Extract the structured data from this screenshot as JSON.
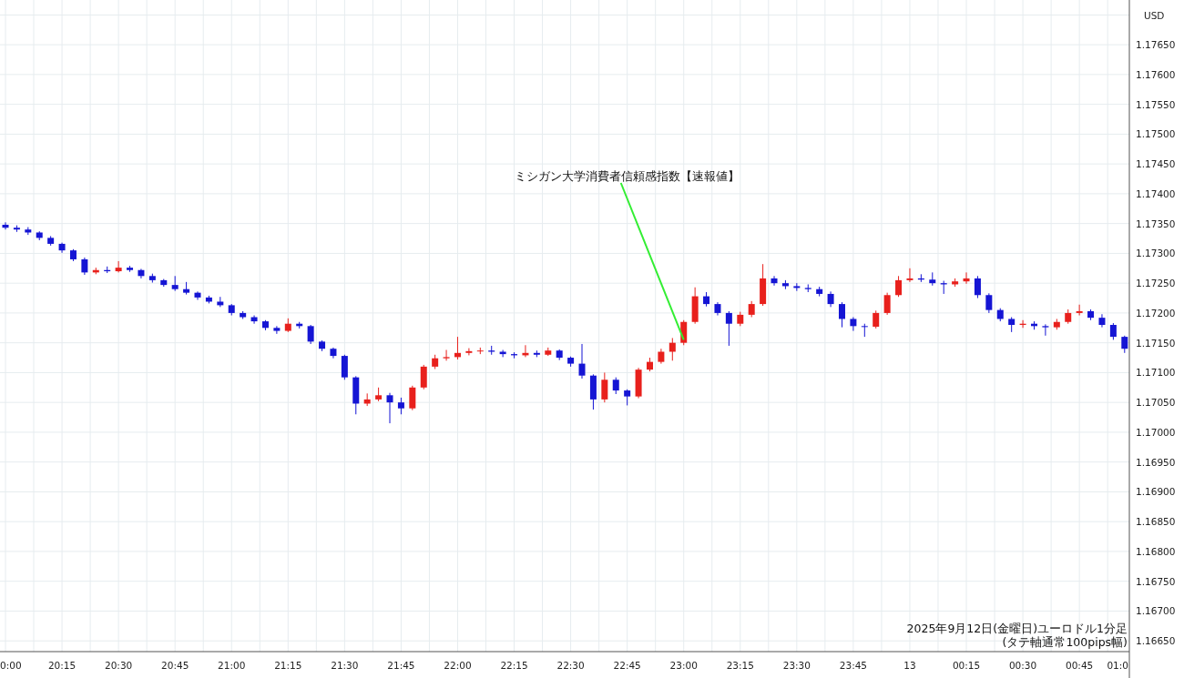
{
  "currency": "USD",
  "chart_data": {
    "type": "candlestick",
    "categories": [
      null,
      null,
      null,
      null,
      null,
      "20:15",
      null,
      null,
      null,
      null,
      "20:30",
      null,
      null,
      null,
      null,
      "20:45",
      null,
      null,
      null,
      null,
      "21:00",
      null,
      null,
      null,
      null,
      "21:15",
      null,
      null,
      null,
      null,
      "21:30",
      null,
      null,
      null,
      null,
      "21:45",
      null,
      null,
      null,
      null,
      "22:00",
      null,
      null,
      null,
      null,
      "22:15",
      null,
      null,
      null,
      null,
      "22:30",
      null,
      null,
      null,
      null,
      "22:45",
      null,
      null,
      null,
      null,
      "23:00",
      null,
      null,
      null,
      null,
      "23:15",
      null,
      null,
      null,
      null,
      "23:30",
      null,
      null,
      null,
      null,
      "23:45",
      null,
      null,
      null,
      null,
      "13",
      null,
      null,
      null,
      null,
      "00:15",
      null,
      null,
      null,
      null,
      "00:30",
      null,
      null,
      null,
      null,
      "00:45",
      null,
      null,
      null,
      null
    ],
    "ohlc": [
      [
        1.17348,
        1.17352,
        1.1734,
        1.17343
      ],
      [
        1.17343,
        1.17347,
        1.17336,
        1.1734
      ],
      [
        1.1734,
        1.17344,
        1.17331,
        1.17335
      ],
      [
        1.17335,
        1.17337,
        1.17322,
        1.17326
      ],
      [
        1.17326,
        1.17329,
        1.17313,
        1.17316
      ],
      [
        1.17316,
        1.17318,
        1.17301,
        1.17305
      ],
      [
        1.17305,
        1.17307,
        1.17287,
        1.1729
      ],
      [
        1.1729,
        1.17293,
        1.17264,
        1.17268
      ],
      [
        1.17268,
        1.17276,
        1.17265,
        1.17272
      ],
      [
        1.17272,
        1.17278,
        1.17267,
        1.1727
      ],
      [
        1.1727,
        1.17287,
        1.17268,
        1.17276
      ],
      [
        1.17276,
        1.17279,
        1.17269,
        1.17272
      ],
      [
        1.17272,
        1.17274,
        1.17258,
        1.17262
      ],
      [
        1.17262,
        1.17266,
        1.17251,
        1.17255
      ],
      [
        1.17255,
        1.17257,
        1.17244,
        1.17247
      ],
      [
        1.17247,
        1.17262,
        1.17237,
        1.1724
      ],
      [
        1.1724,
        1.17252,
        1.17231,
        1.17234
      ],
      [
        1.17234,
        1.17236,
        1.17222,
        1.17226
      ],
      [
        1.17226,
        1.17229,
        1.17216,
        1.17219
      ],
      [
        1.17219,
        1.17227,
        1.1721,
        1.17213
      ],
      [
        1.17213,
        1.17215,
        1.17196,
        1.172
      ],
      [
        1.172,
        1.17203,
        1.1719,
        1.17193
      ],
      [
        1.17193,
        1.17196,
        1.17182,
        1.17186
      ],
      [
        1.17186,
        1.17188,
        1.17171,
        1.17175
      ],
      [
        1.17175,
        1.17178,
        1.17165,
        1.1717
      ],
      [
        1.1717,
        1.17191,
        1.17168,
        1.17182
      ],
      [
        1.17182,
        1.17185,
        1.17174,
        1.17178
      ],
      [
        1.17178,
        1.1718,
        1.17148,
        1.17152
      ],
      [
        1.17152,
        1.17154,
        1.17136,
        1.1714
      ],
      [
        1.1714,
        1.17142,
        1.17124,
        1.17128
      ],
      [
        1.17128,
        1.1713,
        1.17088,
        1.17092
      ],
      [
        1.17092,
        1.17094,
        1.1703,
        1.17048
      ],
      [
        1.17048,
        1.17065,
        1.17044,
        1.17055
      ],
      [
        1.17055,
        1.17075,
        1.17052,
        1.17062
      ],
      [
        1.17062,
        1.17066,
        1.17015,
        1.1705
      ],
      [
        1.1705,
        1.17058,
        1.1703,
        1.1704
      ],
      [
        1.1704,
        1.17078,
        1.17037,
        1.17075
      ],
      [
        1.17075,
        1.17113,
        1.17072,
        1.1711
      ],
      [
        1.1711,
        1.1713,
        1.17106,
        1.17124
      ],
      [
        1.17124,
        1.17138,
        1.1712,
        1.17126
      ],
      [
        1.17126,
        1.1716,
        1.17122,
        1.17133
      ],
      [
        1.17133,
        1.17141,
        1.17129,
        1.17136
      ],
      [
        1.17136,
        1.17142,
        1.17131,
        1.17137
      ],
      [
        1.17137,
        1.17145,
        1.1713,
        1.17135
      ],
      [
        1.17135,
        1.17138,
        1.17126,
        1.17131
      ],
      [
        1.17131,
        1.17134,
        1.17124,
        1.17129
      ],
      [
        1.17129,
        1.17146,
        1.17126,
        1.17133
      ],
      [
        1.17133,
        1.17137,
        1.17126,
        1.1713
      ],
      [
        1.1713,
        1.17142,
        1.17128,
        1.17137
      ],
      [
        1.17137,
        1.17139,
        1.17121,
        1.17125
      ],
      [
        1.17125,
        1.17127,
        1.1711,
        1.17115
      ],
      [
        1.17115,
        1.17148,
        1.1709,
        1.17095
      ],
      [
        1.17095,
        1.17097,
        1.17038,
        1.17055
      ],
      [
        1.17055,
        1.171,
        1.1705,
        1.17088
      ],
      [
        1.17088,
        1.17092,
        1.17064,
        1.1707
      ],
      [
        1.1707,
        1.17072,
        1.17045,
        1.1706
      ],
      [
        1.1706,
        1.17108,
        1.17057,
        1.17105
      ],
      [
        1.17105,
        1.17125,
        1.17102,
        1.17118
      ],
      [
        1.17118,
        1.1714,
        1.17115,
        1.17135
      ],
      [
        1.17135,
        1.17158,
        1.1712,
        1.1715
      ],
      [
        1.1715,
        1.17188,
        1.17146,
        1.17185
      ],
      [
        1.17185,
        1.17243,
        1.17182,
        1.17228
      ],
      [
        1.17228,
        1.17235,
        1.17211,
        1.17215
      ],
      [
        1.17215,
        1.17218,
        1.17196,
        1.172
      ],
      [
        1.172,
        1.17203,
        1.17145,
        1.17182
      ],
      [
        1.17182,
        1.17202,
        1.17178,
        1.17197
      ],
      [
        1.17197,
        1.1722,
        1.17193,
        1.17215
      ],
      [
        1.17215,
        1.17282,
        1.17212,
        1.17258
      ],
      [
        1.17258,
        1.17262,
        1.17246,
        1.1725
      ],
      [
        1.1725,
        1.17255,
        1.1724,
        1.17245
      ],
      [
        1.17245,
        1.1725,
        1.17237,
        1.17242
      ],
      [
        1.17242,
        1.17248,
        1.17235,
        1.1724
      ],
      [
        1.1724,
        1.17244,
        1.17228,
        1.17232
      ],
      [
        1.17232,
        1.17236,
        1.1721,
        1.17215
      ],
      [
        1.17215,
        1.17218,
        1.17176,
        1.1719
      ],
      [
        1.1719,
        1.17193,
        1.1717,
        1.17178
      ],
      [
        1.17178,
        1.17182,
        1.1716,
        1.17177
      ],
      [
        1.17177,
        1.17204,
        1.17174,
        1.172
      ],
      [
        1.172,
        1.17234,
        1.17197,
        1.1723
      ],
      [
        1.1723,
        1.17262,
        1.17227,
        1.17255
      ],
      [
        1.17255,
        1.17275,
        1.17252,
        1.17258
      ],
      [
        1.17258,
        1.17265,
        1.17252,
        1.17256
      ],
      [
        1.17256,
        1.17268,
        1.17246,
        1.1725
      ],
      [
        1.1725,
        1.17254,
        1.17232,
        1.17248
      ],
      [
        1.17248,
        1.17258,
        1.17244,
        1.17253
      ],
      [
        1.17253,
        1.17268,
        1.17249,
        1.17258
      ],
      [
        1.17258,
        1.17262,
        1.17225,
        1.1723
      ],
      [
        1.1723,
        1.17233,
        1.172,
        1.17205
      ],
      [
        1.17205,
        1.17208,
        1.17186,
        1.1719
      ],
      [
        1.1719,
        1.17193,
        1.17168,
        1.1718
      ],
      [
        1.1718,
        1.17188,
        1.17175,
        1.17182
      ],
      [
        1.17182,
        1.17186,
        1.17172,
        1.17178
      ],
      [
        1.17178,
        1.17181,
        1.17162,
        1.17176
      ],
      [
        1.17176,
        1.1719,
        1.17172,
        1.17185
      ],
      [
        1.17185,
        1.17206,
        1.17182,
        1.172
      ],
      [
        1.172,
        1.17214,
        1.17196,
        1.17203
      ],
      [
        1.17203,
        1.17206,
        1.17188,
        1.17192
      ],
      [
        1.17192,
        1.17198,
        1.17176,
        1.1718
      ],
      [
        1.1718,
        1.17183,
        1.17155,
        1.1716
      ],
      [
        1.1716,
        1.17162,
        1.17133,
        1.1714
      ]
    ],
    "ylim": [
      1.16632,
      1.17725
    ],
    "yticks": [
      {
        "value": 1.1765,
        "label": "1.17650"
      },
      {
        "value": 1.176,
        "label": "1.17600"
      },
      {
        "value": 1.1755,
        "label": "1.17550"
      },
      {
        "value": 1.175,
        "label": "1.17500"
      },
      {
        "value": 1.1745,
        "label": "1.17450"
      },
      {
        "value": 1.174,
        "label": "1.17400"
      },
      {
        "value": 1.1735,
        "label": "1.17350"
      },
      {
        "value": 1.173,
        "label": "1.17300"
      },
      {
        "value": 1.1725,
        "label": "1.17250"
      },
      {
        "value": 1.172,
        "label": "1.17200"
      },
      {
        "value": 1.1715,
        "label": "1.17150"
      },
      {
        "value": 1.171,
        "label": "1.17100"
      },
      {
        "value": 1.1705,
        "label": "1.17050"
      },
      {
        "value": 1.17,
        "label": "1.17000"
      },
      {
        "value": 1.1695,
        "label": "1.16950"
      },
      {
        "value": 1.169,
        "label": "1.16900"
      },
      {
        "value": 1.1685,
        "label": "1.16850"
      },
      {
        "value": 1.168,
        "label": "1.16800"
      },
      {
        "value": 1.1675,
        "label": "1.16750"
      },
      {
        "value": 1.167,
        "label": "1.16700"
      },
      {
        "value": 1.1665,
        "label": "1.16650"
      }
    ],
    "annotations": [
      {
        "text": "ミシガン大学消費者信頼感指数【速報値】",
        "x": "23:00",
        "y": 1.17155
      }
    ],
    "grid": true
  },
  "x_axis_start_label": "0:00",
  "x_axis_end_label": "01:0",
  "caption": {
    "lines": [
      "2025年9月12日(金曜日)ユーロドル1分足",
      "(タテ軸通常100pips幅)"
    ]
  }
}
